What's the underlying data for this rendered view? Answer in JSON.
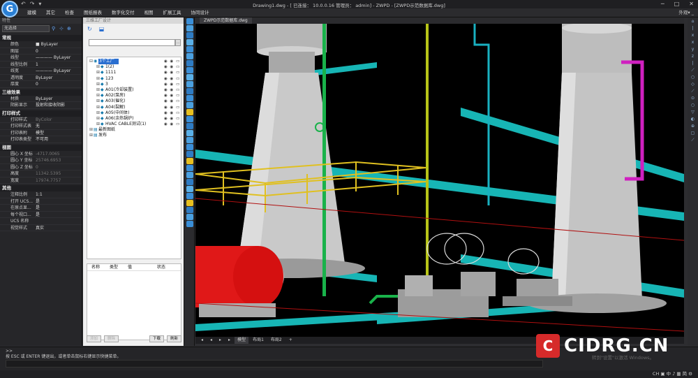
{
  "app": {
    "title": "Drawing1.dwg - [ 已连接： 10.0.0.16  管理员： admin] - ZWPD - [ZWPD示范数据库.dwg]",
    "logo": "G"
  },
  "quick_access": [
    "↶",
    "↷",
    "▾"
  ],
  "window_buttons": [
    "─",
    "□",
    "✕"
  ],
  "menus": [
    "建模",
    "其它",
    "检查",
    "图纸报表",
    "数字化交付",
    "视图",
    "扩展工具",
    "协同设计"
  ],
  "menu_right": "外观▾ _",
  "props": {
    "header": "特性",
    "selection": "无选择",
    "sections": [
      {
        "title": "常规",
        "rows": [
          [
            "颜色",
            "■ ByLayer"
          ],
          [
            "图层",
            "0"
          ],
          [
            "线型",
            "———— ByLayer"
          ],
          [
            "线型比例",
            "1"
          ],
          [
            "线宽",
            "———— ByLayer"
          ],
          [
            "透明度",
            "ByLayer"
          ],
          [
            "厚度",
            "0"
          ]
        ]
      },
      {
        "title": "三维效果",
        "rows": [
          [
            "材质",
            "ByLayer"
          ],
          [
            "阴影显示",
            "投射和接收阴影"
          ]
        ]
      },
      {
        "title": "打印样式",
        "rows": [
          [
            "打印样式",
            "ByColor"
          ],
          [
            "打印样式表",
            "无"
          ],
          [
            "打印表附",
            "模型"
          ],
          [
            "打印表类型",
            "不可用"
          ]
        ]
      },
      {
        "title": "视图",
        "rows": [
          [
            "圆心 X 坐标",
            "-4717.0065"
          ],
          [
            "圆心 Y 坐标",
            "25746.6953"
          ],
          [
            "圆心 Z 坐标",
            "0"
          ],
          [
            "高度",
            "11342.5395"
          ],
          [
            "宽度",
            "17974.7757"
          ]
        ]
      },
      {
        "title": "其他",
        "rows": [
          [
            "注释比例",
            "1:1"
          ],
          [
            "打开 UCS...",
            "是"
          ],
          [
            "在原点显...",
            "是"
          ],
          [
            "每个视口...",
            "是"
          ],
          [
            "UCS 名称",
            ""
          ],
          [
            "视觉样式",
            "真实"
          ]
        ]
      }
    ]
  },
  "panel": {
    "title": "三维工厂设计",
    "tools": [
      "↻",
      "⬓"
    ],
    "search_btn": "...",
    "tree": [
      {
        "label": "3个工厂",
        "level": 0,
        "expander": "⊟",
        "icon": "◉",
        "selected": true
      },
      {
        "label": "1(2)",
        "level": 1,
        "expander": "⊞",
        "icon": "◆",
        "selected": false
      },
      {
        "label": "1111",
        "level": 1,
        "expander": "⊞",
        "icon": "◆",
        "selected": false
      },
      {
        "label": "123",
        "level": 1,
        "expander": "⊞",
        "icon": "◆",
        "selected": false
      },
      {
        "label": "3",
        "level": 1,
        "expander": "⊞",
        "icon": "◆",
        "selected": false
      },
      {
        "label": "A01(冷却装置)",
        "level": 1,
        "expander": "⊞",
        "icon": "◆",
        "selected": false
      },
      {
        "label": "A02(泵房)",
        "level": 1,
        "expander": "⊞",
        "icon": "◆",
        "selected": false
      },
      {
        "label": "A03(催化)",
        "level": 1,
        "expander": "⊞",
        "icon": "◆",
        "selected": false
      },
      {
        "label": "A04(裂解)",
        "level": 1,
        "expander": "⊞",
        "icon": "◆",
        "selected": false
      },
      {
        "label": "A05(中间体)",
        "level": 1,
        "expander": "⊞",
        "icon": "◆",
        "selected": false
      },
      {
        "label": "A06(余热锅炉)",
        "level": 1,
        "expander": "⊞",
        "icon": "◆",
        "selected": false
      },
      {
        "label": "HVAC CABLE测试(1)",
        "level": 1,
        "expander": "⊞",
        "icon": "◆",
        "selected": false
      },
      {
        "label": "最新图纸",
        "level": 0,
        "expander": "⊞",
        "icon": "▤",
        "selected": false
      },
      {
        "label": "发布",
        "level": 0,
        "expander": "⊞",
        "icon": "▤",
        "selected": false
      }
    ],
    "eyes": "◉ ◉ ▭",
    "attr_cols": [
      "名称",
      "类型",
      "值",
      "状态"
    ],
    "buttons": {
      "add": "添加",
      "del": "删除",
      "download": "下载",
      "refresh": "刷新"
    }
  },
  "drawing_tab": "ZWPD示范数据库.dwg",
  "layout_tabs": [
    "◂",
    "◂",
    "▸",
    "▸",
    "模型",
    "布局1",
    "布局2",
    "+"
  ],
  "right_tool_labels": [
    "⌂",
    "|",
    "x",
    "x",
    "y",
    "z",
    "|",
    "⟋",
    "○",
    "◇",
    "⟋",
    "⊙",
    "○",
    "▽",
    "◐",
    "⊕",
    "▢",
    "⟋"
  ],
  "cmd": {
    "history": [
      ">>",
      "按 ESC 或 ENTER 键退出，或者单击鼠标右键显示快捷菜单。"
    ]
  },
  "status_right": "CH  ▣ 中 ♪ ▦ 简 ⚙",
  "watermark": {
    "logo": "C",
    "text": "CIDRG.CN"
  },
  "windows_activation": "转到\"设置\"以激活 Windows。"
}
